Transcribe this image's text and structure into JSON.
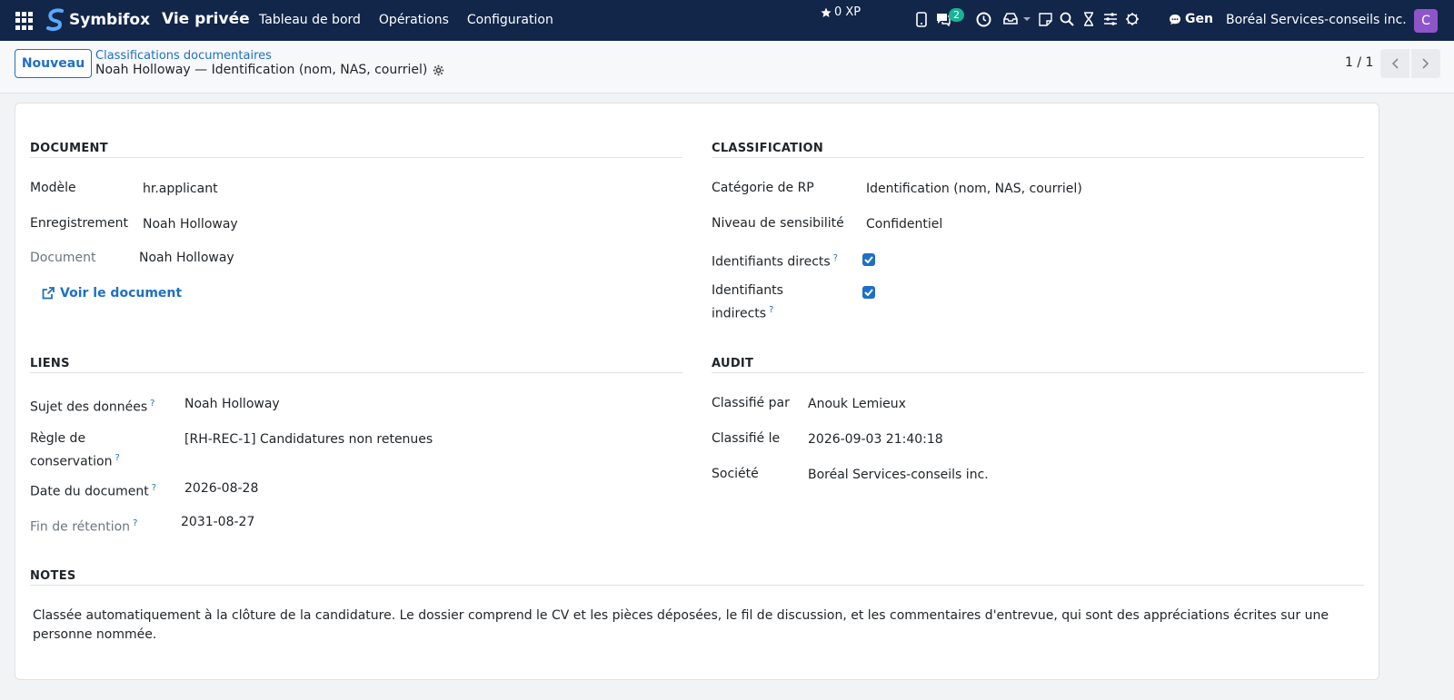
{
  "navbar": {
    "brand": "Symbifox",
    "app_title": "Vie privée",
    "menu": [
      "Tableau de bord",
      "Opérations",
      "Configuration"
    ],
    "xp": "0 XP",
    "messages_count": "2",
    "gen_label": "Gen",
    "company": "Boréal Services-conseils inc.",
    "avatar_initial": "C"
  },
  "control": {
    "new_button": "Nouveau",
    "breadcrumb_parent": "Classifications documentaires",
    "breadcrumb_current": "Noah Holloway — Identification (nom, NAS, courriel)",
    "pager": "1 / 1"
  },
  "document": {
    "title": "DOCUMENT",
    "model_label": "Modèle",
    "model_value": "hr.applicant",
    "record_label": "Enregistrement",
    "record_value": "Noah Holloway",
    "doc_label": "Document",
    "doc_value": "Noah Holloway",
    "view_link": "Voir le document"
  },
  "classification": {
    "title": "CLASSIFICATION",
    "category_label": "Catégorie de RP",
    "category_value": "Identification (nom, NAS, courriel)",
    "sensitivity_label": "Niveau de sensibilité",
    "sensitivity_value": "Confidentiel",
    "direct_label": "Identifiants directs",
    "indirect_label_1": "Identifiants",
    "indirect_label_2": "indirects"
  },
  "links": {
    "title": "LIENS",
    "subject_label": "Sujet des données",
    "subject_value": "Noah Holloway",
    "rule_label_1": "Règle de",
    "rule_label_2": "conservation",
    "rule_value": "[RH-REC-1] Candidatures non retenues",
    "date_label": "Date du document",
    "date_value": "2026-08-28",
    "end_label": "Fin de rétention",
    "end_value": "2031-08-27"
  },
  "audit": {
    "title": "AUDIT",
    "by_label": "Classifié par",
    "by_value": "Anouk Lemieux",
    "on_label": "Classifié le",
    "on_value": "2026-09-03 21:40:18",
    "company_label": "Société",
    "company_value": "Boréal Services-conseils inc."
  },
  "notes": {
    "title": "NOTES",
    "text": "Classée automatiquement à la clôture de la candidature. Le dossier comprend le CV et les pièces déposées, le fil de discussion, et les commentaires d'entrevue, qui sont des appréciations écrites sur une personne nommée."
  },
  "help_mark": "?",
  "colors": {
    "navbar": "#12264a",
    "accent": "#1f6fc5",
    "avatar": "#8e55c9",
    "badge": "#1ab394"
  },
  "icons": [
    "apps-grid-icon",
    "star-icon",
    "phone-icon",
    "chat-icon",
    "clock-icon",
    "inbox-icon",
    "note-icon",
    "search-icon",
    "hourglass-icon",
    "sliders-icon",
    "bug-icon",
    "gear-icon",
    "external-link-icon",
    "chevron-left-icon",
    "chevron-right-icon",
    "check-icon"
  ]
}
